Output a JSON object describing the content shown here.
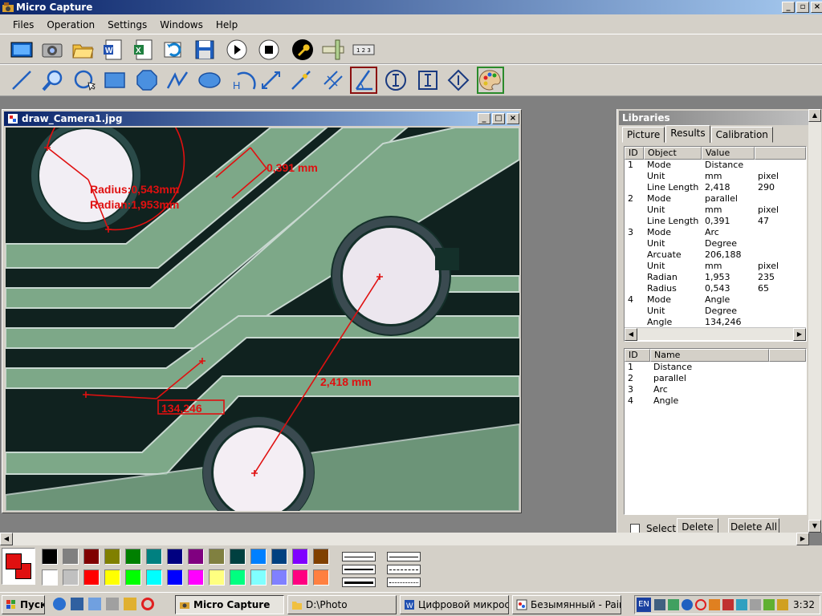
{
  "app": {
    "title": "Micro Capture"
  },
  "menu": [
    "Files",
    "Operation",
    "Settings",
    "Windows",
    "Help"
  ],
  "toolbar1": [
    "video-camera-icon",
    "camera-icon",
    "open-folder-icon",
    "word-document-icon",
    "excel-icon",
    "refresh-icon",
    "save-icon",
    "play-icon",
    "stop-icon",
    "wrench-icon",
    "ruler-icon",
    "scale-ruler-icon"
  ],
  "toolbar2": [
    "line-tool-icon",
    "magnifier-icon",
    "circle-tool-icon",
    "rectangle-tool-icon",
    "polygon-tool-icon",
    "polyline-tool-icon",
    "ellipse-tool-icon",
    "height-tool-icon",
    "arc-tool-icon",
    "distance-tool-icon",
    "point-line-tool-icon",
    "parallel-tool-icon",
    "angle-tool-icon",
    "vertical-ibeam-icon",
    "text-tool-icon",
    "diamond-tool-icon",
    "palette-icon"
  ],
  "image_window": {
    "title": "draw_Camera1.jpg",
    "annotations": {
      "radius": "Radius:0,543mm",
      "radian": "Radian:1,953mm",
      "parallel": "0,391 mm",
      "distance": "2,418 mm",
      "angle": "134,246"
    }
  },
  "libraries": {
    "title": "Libraries",
    "tabs": [
      "Picture",
      "Results",
      "Calibration"
    ],
    "active_tab": "Results",
    "results_columns": [
      "ID",
      "Object",
      "Value",
      ""
    ],
    "results_rows": [
      [
        "1",
        "Mode",
        "Distance",
        ""
      ],
      [
        "",
        "Unit",
        "mm",
        "pixel"
      ],
      [
        "",
        "Line Length",
        "2,418",
        "290"
      ],
      [
        "2",
        "Mode",
        "parallel",
        ""
      ],
      [
        "",
        "Unit",
        "mm",
        "pixel"
      ],
      [
        "",
        "Line Length",
        "0,391",
        "47"
      ],
      [
        "3",
        "Mode",
        "Arc",
        ""
      ],
      [
        "",
        "Unit",
        "Degree",
        ""
      ],
      [
        "",
        "Arcuate",
        "206,188",
        ""
      ],
      [
        "",
        "Unit",
        "mm",
        "pixel"
      ],
      [
        "",
        "Radian",
        "1,953",
        "235"
      ],
      [
        "",
        "Radius",
        "0,543",
        "65"
      ],
      [
        "4",
        "Mode",
        "Angle",
        ""
      ],
      [
        "",
        "Unit",
        "Degree",
        ""
      ],
      [
        "",
        "Angle",
        "134,246",
        ""
      ]
    ],
    "objects_columns": [
      "ID",
      "Name",
      ""
    ],
    "objects_rows": [
      [
        "1",
        "Distance"
      ],
      [
        "2",
        "parallel"
      ],
      [
        "3",
        "Arc"
      ],
      [
        "4",
        "Angle"
      ]
    ],
    "select_all_label": "Select A",
    "delete_label": "Delete",
    "delete_all_label": "Delete All"
  },
  "palette": {
    "primary": "#e01010",
    "secondary": "#e01010",
    "row1": [
      "#000000",
      "#808080",
      "#800000",
      "#808000",
      "#008000",
      "#008080",
      "#000080",
      "#800080",
      "#808040",
      "#004040",
      "#0080ff",
      "#004080",
      "#8000ff",
      "#804000"
    ],
    "row2": [
      "#ffffff",
      "#c0c0c0",
      "#ff0000",
      "#ffff00",
      "#00ff00",
      "#00ffff",
      "#0000ff",
      "#ff00ff",
      "#ffff80",
      "#00ff80",
      "#80ffff",
      "#8080ff",
      "#ff0080",
      "#ff8040"
    ]
  },
  "taskbar": {
    "start": "Пуск",
    "tasks": [
      "Micro Capture",
      "D:\\Photo",
      "Цифровой микроск...",
      "Безымянный - Paint"
    ],
    "active_task": "Micro Capture",
    "lang": "EN",
    "clock": "3:32"
  }
}
